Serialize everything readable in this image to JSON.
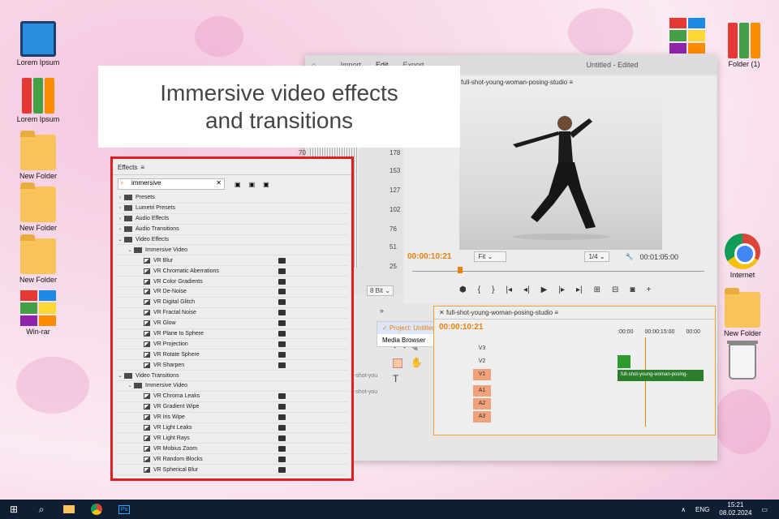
{
  "desktop": {
    "left_icons": [
      {
        "label": "Lorem Ipsum",
        "icon": "computer-icon"
      },
      {
        "label": "Lorem Ipsum",
        "icon": "binders-icon"
      },
      {
        "label": "New Folder",
        "icon": "folder-icon"
      },
      {
        "label": "New Folder",
        "icon": "folder-icon"
      },
      {
        "label": "New Folder",
        "icon": "folder-icon"
      },
      {
        "label": "Win-rar",
        "icon": "winrar-icon"
      }
    ],
    "right_icons": [
      {
        "label": "",
        "icon": "winrar-icon"
      },
      {
        "label": "Folder (1)",
        "icon": "binders-icon"
      },
      {
        "label": "Internet",
        "icon": "chrome-icon"
      },
      {
        "label": "New Folder",
        "icon": "folder-icon"
      },
      {
        "label": "",
        "icon": "recycle-bin-icon"
      }
    ]
  },
  "caption": {
    "line1": "Immersive video effects",
    "line2": "and transitions"
  },
  "app": {
    "tabs": [
      "Import",
      "Edit",
      "Export"
    ],
    "window_title": "Untitled",
    "window_status": "- Edited",
    "program_monitor": {
      "sequence": "full-shot-young-woman-posing-studio",
      "timecode": "00:00:10:21",
      "fit": "Fit",
      "resolution": "1/4",
      "duration": "00:01:05:00"
    },
    "scope_numbers": [
      "178",
      "153",
      "127",
      "102",
      "76",
      "51",
      "25"
    ],
    "scope_left_number": "70",
    "bit_depth": "8 Bit",
    "context_menu": [
      "Project: Untitled",
      "Media Browser"
    ],
    "timeline": {
      "sequence": "full-shot-young-woman-posing-studio",
      "timecode": "00:00:10:21",
      "ruler": [
        ":00:00",
        "00:00:15:00",
        "00:00"
      ],
      "tracks": [
        "V3",
        "V2",
        "V1",
        "A1",
        "A2",
        "A3"
      ],
      "clip": "full-shot-young-woman-posing-"
    },
    "project_items": [
      "-shot-you",
      "-shot-you"
    ]
  },
  "effects_panel": {
    "title": "Effects",
    "search": "immersive",
    "rows": [
      {
        "level": 0,
        "type": "folder",
        "label": "Presets"
      },
      {
        "level": 0,
        "type": "folder",
        "label": "Lumetri Presets"
      },
      {
        "level": 0,
        "type": "folder",
        "label": "Audio Effects"
      },
      {
        "level": 0,
        "type": "folder",
        "label": "Audio Transitions"
      },
      {
        "level": 0,
        "type": "folder-open",
        "label": "Video Effects"
      },
      {
        "level": 1,
        "type": "folder-open",
        "label": "Immersive Video"
      },
      {
        "level": 2,
        "type": "effect",
        "label": "VR Blur"
      },
      {
        "level": 2,
        "type": "effect",
        "label": "VR Chromatic Aberrations"
      },
      {
        "level": 2,
        "type": "effect",
        "label": "VR Color Gradients"
      },
      {
        "level": 2,
        "type": "effect",
        "label": "VR De-Noise"
      },
      {
        "level": 2,
        "type": "effect",
        "label": "VR Digital Glitch"
      },
      {
        "level": 2,
        "type": "effect",
        "label": "VR Fractal Noise"
      },
      {
        "level": 2,
        "type": "effect",
        "label": "VR Glow"
      },
      {
        "level": 2,
        "type": "effect",
        "label": "VR Plane to Sphere"
      },
      {
        "level": 2,
        "type": "effect",
        "label": "VR Projection"
      },
      {
        "level": 2,
        "type": "effect",
        "label": "VR Rotate Sphere"
      },
      {
        "level": 2,
        "type": "effect",
        "label": "VR Sharpen"
      },
      {
        "level": 0,
        "type": "folder-open",
        "label": "Video Transitions"
      },
      {
        "level": 1,
        "type": "folder-open",
        "label": "Immersive Video"
      },
      {
        "level": 2,
        "type": "transition",
        "label": "VR Chroma Leaks"
      },
      {
        "level": 2,
        "type": "transition",
        "label": "VR Gradient Wipe"
      },
      {
        "level": 2,
        "type": "transition",
        "label": "VR Iris Wipe"
      },
      {
        "level": 2,
        "type": "transition",
        "label": "VR Light Leaks"
      },
      {
        "level": 2,
        "type": "transition",
        "label": "VR Light Rays"
      },
      {
        "level": 2,
        "type": "transition",
        "label": "VR Mobius Zoom"
      },
      {
        "level": 2,
        "type": "transition",
        "label": "VR Random Blocks"
      },
      {
        "level": 2,
        "type": "transition",
        "label": "VR Spherical Blur"
      }
    ]
  },
  "taskbar": {
    "apps": [
      "windows-start-icon",
      "search-icon",
      "file-explorer-icon",
      "chrome-icon",
      "photoshop-icon"
    ],
    "ps_label": "Ps",
    "lang": "ENG",
    "time": "15:21",
    "date": "08.02.2024"
  },
  "colors": {
    "accent": "#e8820c",
    "highlight_border": "#e02020",
    "taskbar": "#0f1e33"
  }
}
